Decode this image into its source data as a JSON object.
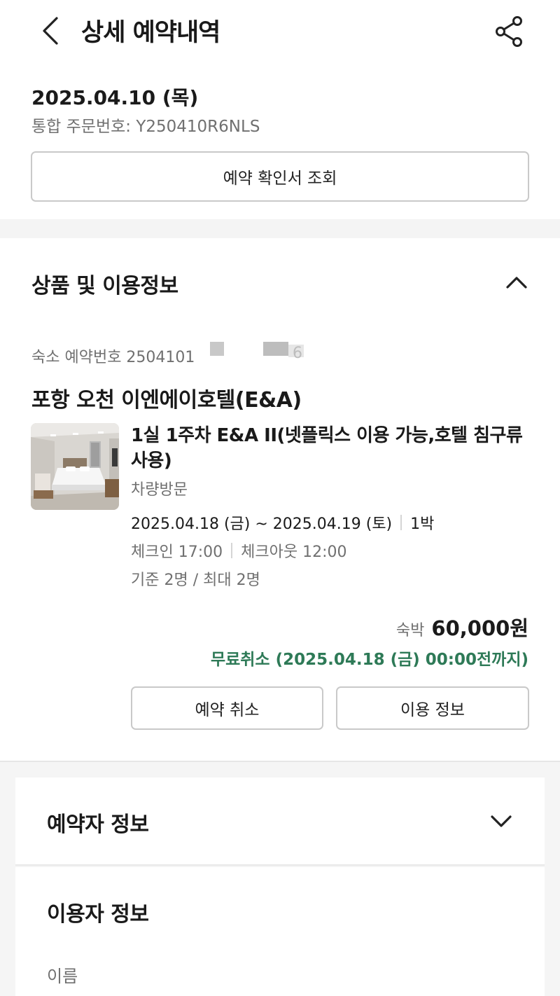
{
  "header": {
    "title": "상세 예약내역",
    "back_icon": "chevron-left-icon",
    "share_icon": "share-icon"
  },
  "order": {
    "date": "2025.04.10 (목)",
    "number": "통합 주문번호: Y250410R6NLS",
    "confirm_button": "예약 확인서 조회"
  },
  "product_section": {
    "title": "상품 및 이용정보",
    "reservation_number": "숙소 예약번호 2504101",
    "reservation_number_tail": "6",
    "hotel_name": "포항 오천 이엔에이호텔(E&A)",
    "room_name": "1실 1주차 E&A II(넷플릭스 이용 가능,호텔 침구류 사용)",
    "room_note": "차량방문",
    "stay_dates": "2025.04.18 (금) ~ 2025.04.19 (토)",
    "nights": "1박",
    "checkin": "체크인 17:00",
    "checkout": "체크아웃 12:00",
    "occupancy": "기준 2명 / 최대 2명",
    "price_label": "숙박",
    "price_value": "60,000원",
    "cancel_note": "무료취소 (2025.04.18 (금) 00:00전까지)",
    "cancel_button": "예약 취소",
    "info_button": "이용 정보"
  },
  "booker_section": {
    "title": "예약자 정보"
  },
  "user_section": {
    "title": "이용자 정보",
    "name_label": "이름"
  },
  "colors": {
    "accent_green": "#2e7a57",
    "muted_text": "#707070",
    "border": "#c9c9c9"
  }
}
